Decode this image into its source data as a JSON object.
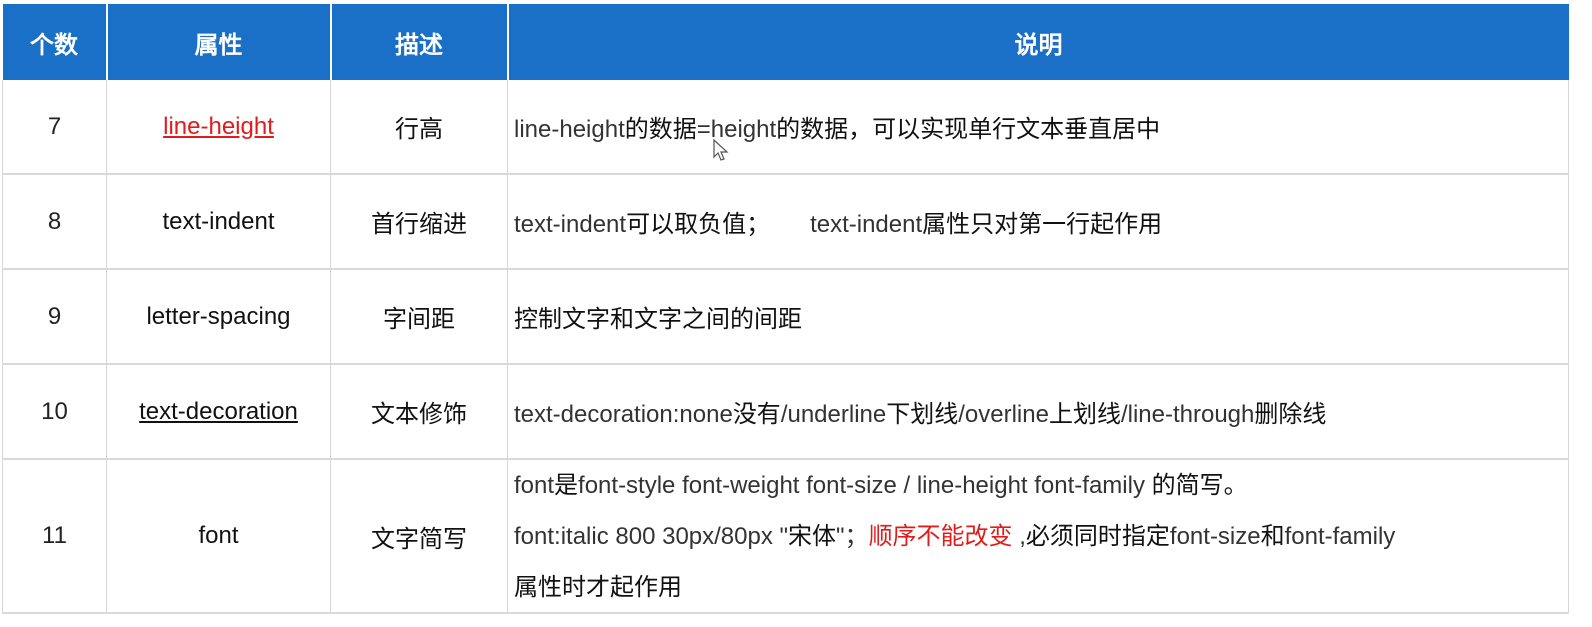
{
  "header": {
    "count": "个数",
    "property": "属性",
    "description": "描述",
    "explanation": "说明"
  },
  "rows": [
    {
      "num": "7",
      "prop": "line-height",
      "desc": "行高",
      "expl": [
        "line-height",
        "的数据",
        "=height",
        "的数据，可以实现单行文本垂直居中"
      ]
    },
    {
      "num": "8",
      "prop": "text-indent",
      "desc": "首行缩进",
      "expl": [
        "text-indent",
        "可以取负值；",
        "text-indent",
        "属性只对第一行起作用"
      ]
    },
    {
      "num": "9",
      "prop": "letter-spacing",
      "desc": "字间距",
      "expl": [
        "控制文字和文字之间的间距"
      ]
    },
    {
      "num": "10",
      "prop": "text-decoration",
      "desc": "文本修饰",
      "expl": [
        "text-decoration:none",
        "没有",
        "/underline",
        "下划线",
        "/overline",
        "上划线",
        "/line-through",
        "删除线"
      ]
    },
    {
      "num": "11",
      "prop": "font",
      "desc": "文字简写",
      "expl_line1": [
        "font",
        "是",
        "font-style font-weight font-size / line-height font-family ",
        "的简写。"
      ],
      "expl_line2": [
        "font:italic  800 30px/80px \"",
        "宋体",
        "\"；",
        "顺序不能改变",
        " ,",
        "必须同时指定",
        "font-size",
        "和",
        "font-family"
      ],
      "expl_line3": "属性时才起作用"
    }
  ]
}
